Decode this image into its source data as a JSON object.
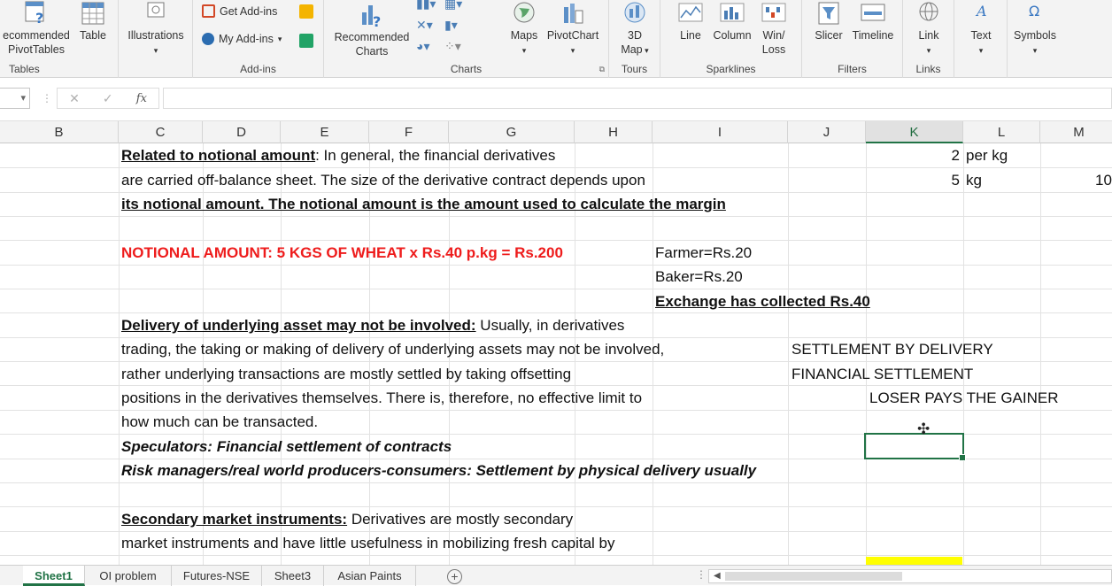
{
  "ribbon": {
    "groups": {
      "tables": "Tables",
      "addins": "Add-ins",
      "charts": "Charts",
      "tours": "Tours",
      "sparklines": "Sparklines",
      "filters": "Filters",
      "links": "Links"
    },
    "buttons": {
      "recommended_pivottables": [
        "ecommended",
        "PivotTables"
      ],
      "table": "Table",
      "illustrations": "Illustrations",
      "get_addins": "Get Add-ins",
      "my_addins": "My Add-ins",
      "recommended_charts": [
        "Recommended",
        "Charts"
      ],
      "maps": "Maps",
      "pivotchart": "PivotChart",
      "map3d": [
        "3D",
        "Map"
      ],
      "line": "Line",
      "column": "Column",
      "winloss": [
        "Win/",
        "Loss"
      ],
      "slicer": "Slicer",
      "timeline": "Timeline",
      "link": "Link",
      "text": "Text",
      "symbols": "Symbols"
    }
  },
  "formula_bar": {
    "cancel": "✕",
    "enter": "✓",
    "fx": "fx",
    "value": ""
  },
  "columns": [
    "B",
    "C",
    "D",
    "E",
    "F",
    "G",
    "H",
    "I",
    "J",
    "K",
    "L",
    "M"
  ],
  "selected_column": "K",
  "cells": {
    "r1_c": "Related to notional amount",
    "r1_c_rest": ": In general, the financial derivatives",
    "r1_k": "2",
    "r1_l": "per kg",
    "r2_c": "are carried off-balance sheet. The size of the derivative contract depends upon",
    "r2_k": "5",
    "r2_l": "kg",
    "r2_m": "10",
    "r3_c": "its notional amount. The notional amount is the amount used to calculate the margin",
    "r5_c": "NOTIONAL AMOUNT: 5 KGS OF WHEAT x Rs.40 p.kg = Rs.200",
    "r5_i": "Farmer=Rs.20",
    "r6_i": "Baker=Rs.20",
    "r7_i": "Exchange has collected Rs.40",
    "r8_c": "Delivery of underlying asset may not be involved:",
    "r8_c_rest": " Usually, in derivatives",
    "r9_c": "trading, the taking or making of delivery of underlying assets may not be involved,",
    "r9_j": "SETTLEMENT BY DELIVERY",
    "r10_c": "rather underlying transactions are mostly settled by taking offsetting",
    "r10_j": "FINANCIAL SETTLEMENT",
    "r11_c": "positions in the derivatives themselves. There is, therefore, no effective limit to",
    "r11_k": "LOSER PAYS THE GAINER",
    "r12_c": "how much can be transacted.",
    "r13_c": "Speculators: Financial settlement of contracts",
    "r14_c": "Risk managers/real world producers-consumers: Settlement by physical delivery usually",
    "r16_c": "Secondary market instruments:",
    "r16_c_rest": " Derivatives are mostly secondary",
    "r17_c": "market instruments and have little usefulness in mobilizing fresh capital by"
  },
  "sheets": [
    "Sheet1",
    "OI problem",
    "Futures-NSE",
    "Sheet3",
    "Asian Paints"
  ],
  "active_sheet": "Sheet1",
  "colors": {
    "excel_green": "#217346",
    "red_text": "#ee1c1c",
    "highlight_yellow": "#ffff00"
  }
}
